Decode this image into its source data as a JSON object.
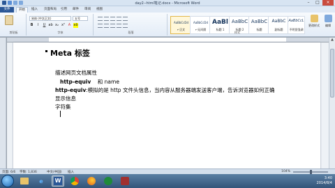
{
  "window": {
    "title": "day2--html笔记.docx - Microsoft Word"
  },
  "tabs": [
    "文件",
    "开始",
    "插入",
    "页面布局",
    "引用",
    "邮件",
    "审阅",
    "视图"
  ],
  "ribbon": {
    "font_name": "宋体 (中文正文)",
    "font_size": "五号",
    "styles": [
      {
        "sample": "AaBbCcDd",
        "name": "↵正文"
      },
      {
        "sample": "AaBbCcDd",
        "name": "↵无间隔"
      },
      {
        "sample": "AaBl",
        "name": "标题 1"
      },
      {
        "sample": "AaBbC",
        "name": "标题 2"
      },
      {
        "sample": "AaBbC",
        "name": "标题"
      },
      {
        "sample": "AaBbC",
        "name": "副标题"
      },
      {
        "sample": "AaBbCcL",
        "name": "不明显强调"
      }
    ],
    "change_styles": "更改样式",
    "edit": "编辑",
    "groups": {
      "clipboard": "剪贴板",
      "font": "字体",
      "paragraph": "段落",
      "styles": "样式"
    }
  },
  "document": {
    "heading": "Meta 标签",
    "line1": "描述网页文档属性",
    "line2_a": "http-equiv",
    "line2_b": "和 name",
    "line3_bold": "http-equiv",
    "line3_rest": ":模拟的是 http 文件头信息，当内容从服务器端发送客户端，告诉浏览器如何正确",
    "line4": "显示信息",
    "line5": "字符集"
  },
  "status": {
    "page": "页面: 6/6",
    "words": "字数: 1,836",
    "lang": "中文(中国)",
    "mode": "插入",
    "zoom": "104%"
  },
  "taskbar": {
    "apps": [
      "explorer",
      "ie",
      "word",
      "chrome",
      "firefox",
      "media",
      "other"
    ],
    "time": "3:40",
    "date": "2014/8/4"
  }
}
